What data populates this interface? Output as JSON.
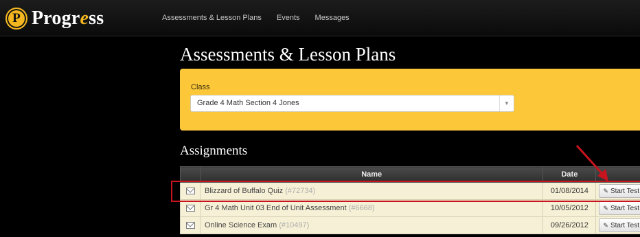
{
  "app": {
    "logo_prefix": "Progr",
    "logo_highlight": "e",
    "logo_suffix": "ss",
    "logo_mark": "P"
  },
  "nav": [
    {
      "label": "Assessments & Lesson Plans"
    },
    {
      "label": "Events"
    },
    {
      "label": "Messages"
    }
  ],
  "page": {
    "title": "Assessments & Lesson Plans"
  },
  "class_filter": {
    "label": "Class",
    "selected": "Grade 4 Math Section 4 Jones"
  },
  "assignments": {
    "title": "Assignments",
    "columns": {
      "name": "Name",
      "date": "Date"
    },
    "rows": [
      {
        "name": "Blizzard of Buffalo Quiz",
        "id": "(#72734)",
        "date": "01/08/2014",
        "action": "Start Test"
      },
      {
        "name": "Gr 4 Math Unit 03 End of Unit Assessment",
        "id": "(#6668)",
        "date": "10/05/2012",
        "action": "Start Test"
      },
      {
        "name": "Online Science Exam",
        "id": "(#10497)",
        "date": "09/26/2012",
        "action": "Start Test"
      }
    ]
  },
  "colors": {
    "brand_gold": "#f3b61f",
    "panel_yellow": "#fcc83a",
    "highlight_red": "#c8141e"
  }
}
